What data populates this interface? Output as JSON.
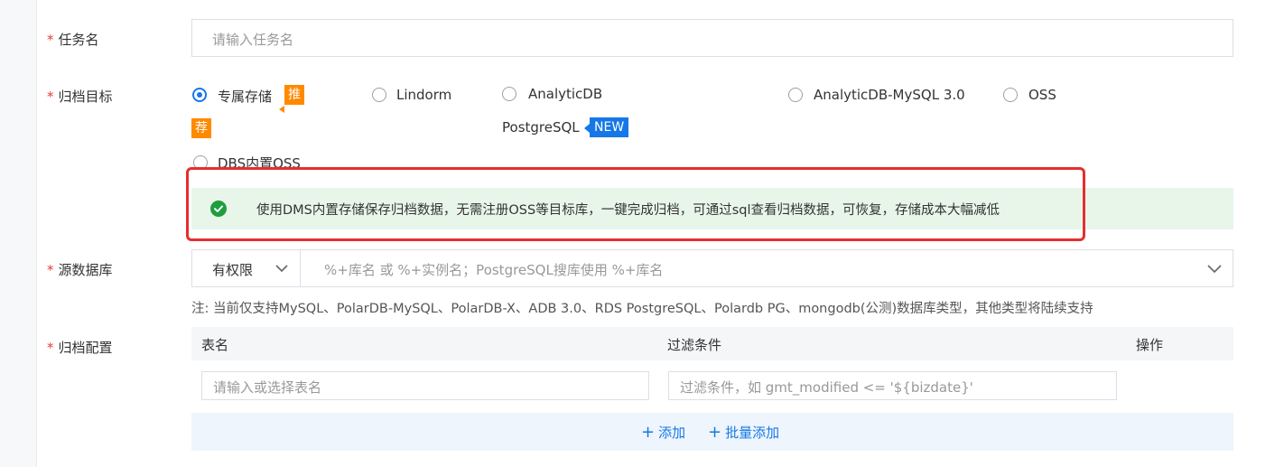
{
  "form": {
    "task_name": {
      "label": "任务名",
      "required": "*",
      "placeholder": "请输入任务名"
    },
    "archive_target": {
      "label": "归档目标",
      "required": "*",
      "options": [
        {
          "label": "专属存储",
          "badge": "推荐",
          "selected": true
        },
        {
          "label": "Lindorm",
          "selected": false
        },
        {
          "label_line1": "AnalyticDB",
          "label_line2": "PostgreSQL",
          "badge": "NEW",
          "selected": false
        },
        {
          "label": "AnalyticDB-MySQL 3.0",
          "selected": false
        },
        {
          "label": "OSS",
          "selected": false
        },
        {
          "label": "DBS内置OSS",
          "selected": false
        }
      ],
      "tip": "使用DMS内置存储保存归档数据，无需注册OSS等目标库，一键完成归档，可通过sql查看归档数据，可恢复，存储成本大幅减低"
    },
    "source_db": {
      "label": "源数据库",
      "required": "*",
      "permission": "有权限",
      "placeholder": "%+库名 或 %+实例名；PostgreSQL搜库使用 %+库名",
      "note": "注:  当前仅支持MySQL、PolarDB-MySQL、PolarDB-X、ADB 3.0、RDS PostgreSQL、Polardb PG、mongodb(公测)数据库类型，其他类型将陆续支持"
    },
    "archive_config": {
      "label": "归档配置",
      "required": "*",
      "columns": [
        "表名",
        "过滤条件",
        "操作"
      ],
      "table_placeholder": "请输入或选择表名",
      "filter_placeholder": "过滤条件，如 gmt_modified <= '${bizdate}'",
      "add": "添加",
      "bulk_add": "批量添加"
    }
  },
  "colors": {
    "accent": "#1678e6",
    "required": "#e23e3e",
    "recommend": "#ff8a00",
    "tip_bg": "#e8f6ea",
    "success": "#1e9e3e",
    "callout": "#e52f2f"
  }
}
